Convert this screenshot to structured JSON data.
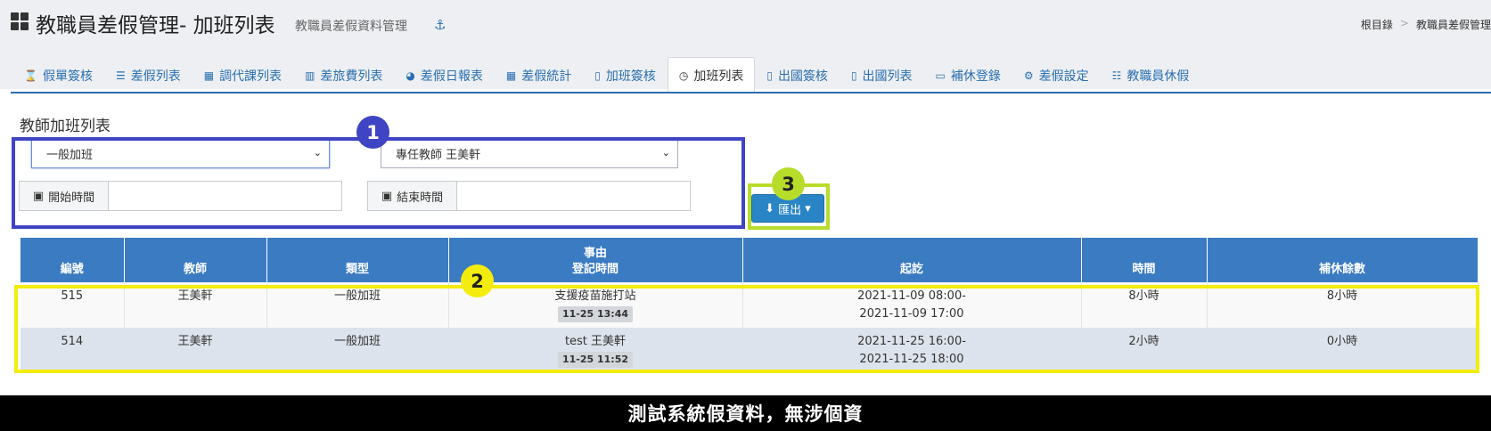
{
  "header": {
    "title": "教職員差假管理- 加班列表",
    "subtitle": "教職員差假資料管理",
    "breadcrumb": [
      "根目錄",
      "教職員差假管理"
    ],
    "breadcrumb_sep": ">"
  },
  "tabs": [
    {
      "label": "假單簽核",
      "icon": "hourglass-icon",
      "glyph": "⌛"
    },
    {
      "label": "差假列表",
      "icon": "list-icon",
      "glyph": "☰"
    },
    {
      "label": "調代課列表",
      "icon": "table-icon",
      "glyph": "▦"
    },
    {
      "label": "差旅費列表",
      "icon": "bar-chart-icon",
      "glyph": "▥"
    },
    {
      "label": "差假日報表",
      "icon": "pie-chart-icon",
      "glyph": "◕"
    },
    {
      "label": "差假統計",
      "icon": "calculator-icon",
      "glyph": "▦"
    },
    {
      "label": "加班簽核",
      "icon": "file-icon",
      "glyph": "▯"
    },
    {
      "label": "加班列表",
      "icon": "clock-icon",
      "glyph": "◷",
      "active": true
    },
    {
      "label": "出國簽核",
      "icon": "file-icon",
      "glyph": "▯"
    },
    {
      "label": "出國列表",
      "icon": "file-icon",
      "glyph": "▯"
    },
    {
      "label": "補休登錄",
      "icon": "money-icon",
      "glyph": "▭"
    },
    {
      "label": "差假設定",
      "icon": "cogs-icon",
      "glyph": "⚙"
    },
    {
      "label": "教職員休假",
      "icon": "sliders-icon",
      "glyph": "☷"
    }
  ],
  "section": {
    "title": "教師加班列表"
  },
  "filters": {
    "type_select": "一般加班",
    "teacher_select": "專任教師 王美軒",
    "start_label": "開始時間",
    "start_value": "",
    "end_label": "結束時間",
    "end_value": ""
  },
  "export": {
    "label": "匯出"
  },
  "badges": [
    "1",
    "2",
    "3"
  ],
  "table": {
    "headers": [
      "編號",
      "教師",
      "類型",
      "事由",
      "登記時間",
      "起訖",
      "時間",
      "補休餘數"
    ],
    "rows": [
      {
        "id": "515",
        "teacher": "王美軒",
        "type": "一般加班",
        "reason": "支援疫苗施打站",
        "reg_time": "11-25 13:44",
        "start": "2021-11-09 08:00-",
        "end": "2021-11-09 17:00",
        "hours": "8小時",
        "remaining": "8小時"
      },
      {
        "id": "514",
        "teacher": "王美軒",
        "type": "一般加班",
        "reason": "test 王美軒",
        "reg_time": "11-25 11:52",
        "start": "2021-11-25 16:00-",
        "end": "2021-11-25 18:00",
        "hours": "2小時",
        "remaining": "0小時"
      }
    ]
  },
  "footer": {
    "notice": "測試系統假資料，無涉個資"
  },
  "colors": {
    "accent": "#2a6fb0",
    "table_header": "#3a7bc2",
    "highlight_1": "#3f44c4",
    "highlight_2": "#f3ec0c",
    "highlight_3": "#b7dc2a"
  }
}
